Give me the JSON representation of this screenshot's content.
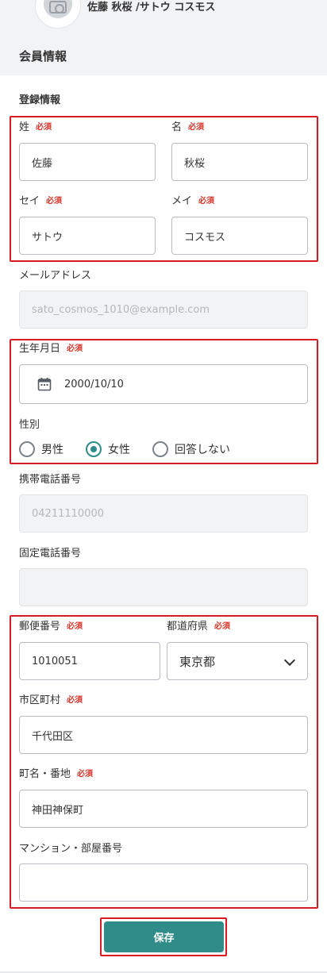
{
  "header": {
    "user_name": "佐藤 秋桜 /サトウ コスモス",
    "section_title": "会員情報"
  },
  "form": {
    "subtitle": "登録情報",
    "required_label": "必須",
    "last_name": {
      "label": "姓",
      "value": "佐藤"
    },
    "first_name": {
      "label": "名",
      "value": "秋桜"
    },
    "last_name_kana": {
      "label": "セイ",
      "value": "サトウ"
    },
    "first_name_kana": {
      "label": "メイ",
      "value": "コスモス"
    },
    "email": {
      "label": "メールアドレス",
      "value": "sato_cosmos_1010@example.com"
    },
    "birthday": {
      "label": "生年月日",
      "value": "2000/10/10",
      "icon": "calendar-icon"
    },
    "gender": {
      "label": "性別",
      "options": [
        "男性",
        "女性",
        "回答しない"
      ],
      "selected": "女性"
    },
    "mobile": {
      "label": "携帯電話番号",
      "value": "04211110000"
    },
    "phone": {
      "label": "固定電話番号",
      "value": ""
    },
    "postal": {
      "label": "郵便番号",
      "value": "1010051"
    },
    "prefecture": {
      "label": "都道府県",
      "value": "東京都"
    },
    "city": {
      "label": "市区町村",
      "value": "千代田区"
    },
    "town": {
      "label": "町名・番地",
      "value": "神田神保町"
    },
    "building": {
      "label": "マンション・部屋番号",
      "value": ""
    },
    "save_label": "保存"
  },
  "colors": {
    "accent": "#2f8c89",
    "required": "#d9362b",
    "highlight_border": "#d81a22"
  }
}
